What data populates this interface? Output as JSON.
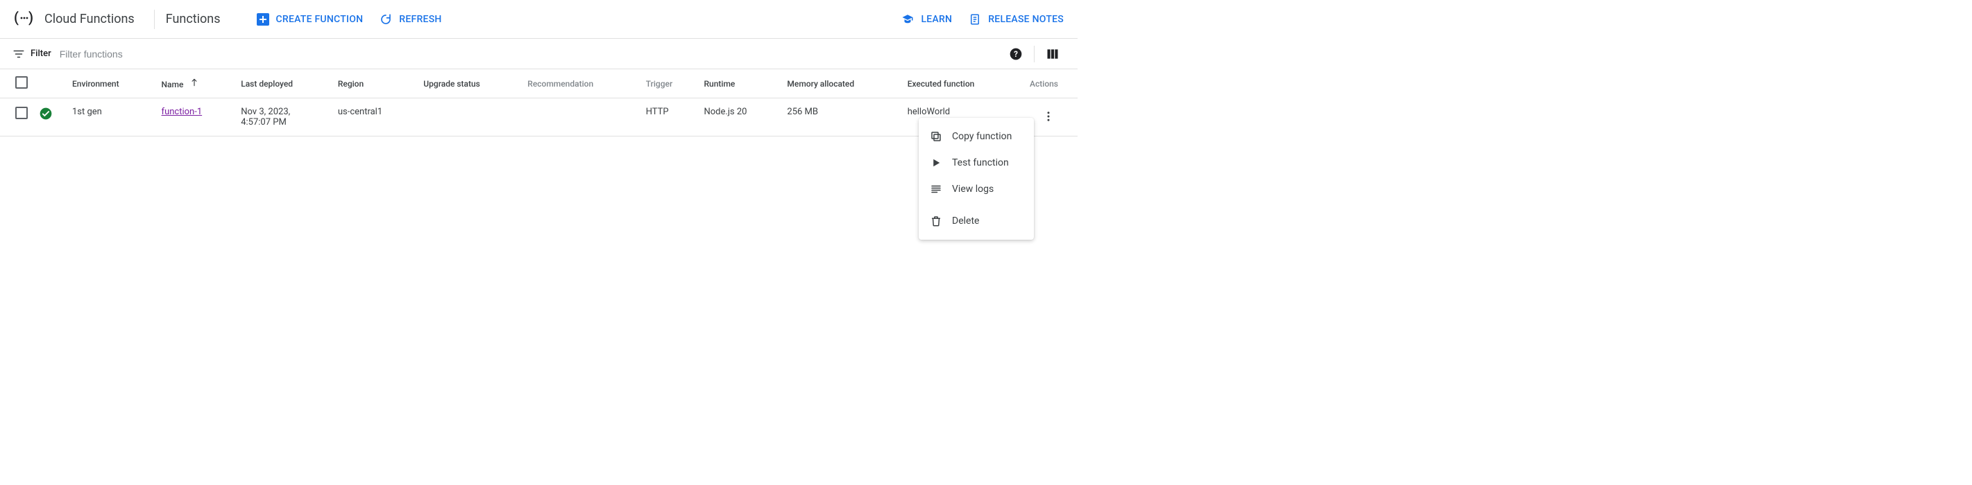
{
  "header": {
    "product": "Cloud Functions",
    "page": "Functions",
    "create": "Create function",
    "refresh": "Refresh",
    "learn": "Learn",
    "release_notes": "Release notes"
  },
  "filter": {
    "label": "Filter",
    "placeholder": "Filter functions"
  },
  "columns": {
    "environment": "Environment",
    "name": "Name",
    "last_deployed": "Last deployed",
    "region": "Region",
    "upgrade_status": "Upgrade status",
    "recommendation": "Recommendation",
    "trigger": "Trigger",
    "runtime": "Runtime",
    "memory": "Memory allocated",
    "executed_fn": "Executed function",
    "actions": "Actions"
  },
  "rows": [
    {
      "environment": "1st gen",
      "name": "function-1",
      "last_deployed_line1": "Nov 3, 2023,",
      "last_deployed_line2": "4:57:07 PM",
      "region": "us-central1",
      "upgrade_status": "",
      "recommendation": "",
      "trigger": "HTTP",
      "runtime": "Node.js 20",
      "memory": "256 MB",
      "executed_fn": "helloWorld"
    }
  ],
  "menu": {
    "copy": "Copy function",
    "test": "Test function",
    "logs": "View logs",
    "delete": "Delete"
  }
}
